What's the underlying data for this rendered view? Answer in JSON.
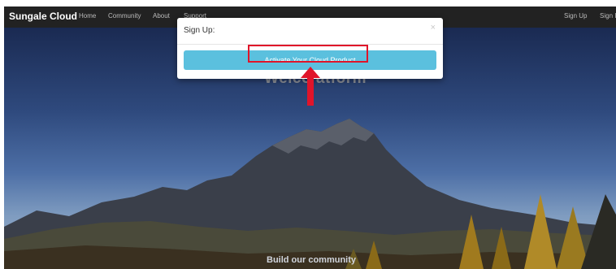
{
  "navbar": {
    "brand": "Sungale Cloud",
    "links": [
      "Home",
      "Community",
      "About",
      "Support"
    ],
    "right_links": [
      "Sign Up",
      "Sign I"
    ]
  },
  "hero": {
    "welcome_text": "Welco                           atform",
    "tagline": "Build our community"
  },
  "modal": {
    "title": "Sign Up:",
    "close_symbol": "×",
    "button_label": "Activate Your Cloud Product"
  },
  "colors": {
    "navbar": "#222222",
    "button": "#5bc0de",
    "highlight": "#e0142a"
  }
}
